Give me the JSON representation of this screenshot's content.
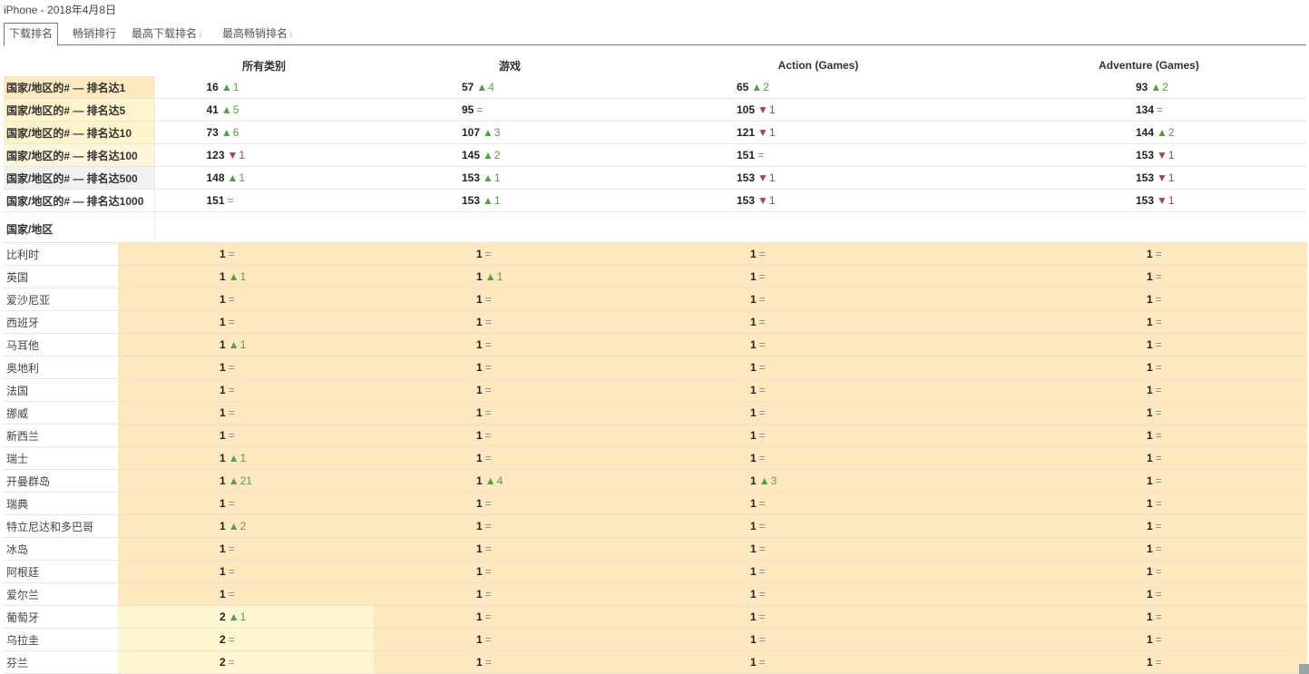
{
  "title": "iPhone - 2018年4月8日",
  "tabs": [
    {
      "label": "下载排名",
      "active": true,
      "info": ""
    },
    {
      "label": "畅销排行",
      "active": false,
      "info": ""
    },
    {
      "label": "最高下载排名",
      "active": false,
      "info": "i"
    },
    {
      "label": "最高畅销排名",
      "active": false,
      "info": "i"
    }
  ],
  "columns": [
    "所有类别",
    "游戏",
    "Action (Games)",
    "Adventure (Games)"
  ],
  "summary_rows": [
    {
      "label": "国家/地区的# — 排名达1",
      "level": "lvl1",
      "cells": [
        [
          "16",
          "up",
          "1"
        ],
        [
          "57",
          "up",
          "4"
        ],
        [
          "65",
          "up",
          "2"
        ],
        [
          "93",
          "up",
          "2"
        ]
      ]
    },
    {
      "label": "国家/地区的# — 排名达5",
      "level": "lvl5",
      "cells": [
        [
          "41",
          "up",
          "5"
        ],
        [
          "95",
          "eq",
          ""
        ],
        [
          "105",
          "down",
          "1"
        ],
        [
          "134",
          "eq",
          ""
        ]
      ]
    },
    {
      "label": "国家/地区的# — 排名达10",
      "level": "lvl5",
      "cells": [
        [
          "73",
          "up",
          "6"
        ],
        [
          "107",
          "up",
          "3"
        ],
        [
          "121",
          "down",
          "1"
        ],
        [
          "144",
          "up",
          "2"
        ]
      ]
    },
    {
      "label": "国家/地区的# — 排名达100",
      "level": "lvl100",
      "cells": [
        [
          "123",
          "down",
          "1"
        ],
        [
          "145",
          "up",
          "2"
        ],
        [
          "151",
          "eq",
          ""
        ],
        [
          "153",
          "down",
          "1"
        ]
      ]
    },
    {
      "label": "国家/地区的# — 排名达500",
      "level": "lvl500",
      "cells": [
        [
          "148",
          "up",
          "1"
        ],
        [
          "153",
          "up",
          "1"
        ],
        [
          "153",
          "down",
          "1"
        ],
        [
          "153",
          "down",
          "1"
        ]
      ]
    },
    {
      "label": "国家/地区的# — 排名达1000",
      "level": "lvl1000",
      "cells": [
        [
          "151",
          "eq",
          ""
        ],
        [
          "153",
          "up",
          "1"
        ],
        [
          "153",
          "down",
          "1"
        ],
        [
          "153",
          "down",
          "1"
        ]
      ]
    }
  ],
  "country_header": "国家/地区",
  "countries": [
    {
      "name": "比利时",
      "cells": [
        [
          "1",
          "eq",
          ""
        ],
        [
          "1",
          "eq",
          ""
        ],
        [
          "1",
          "eq",
          ""
        ],
        [
          "1",
          "eq",
          ""
        ]
      ]
    },
    {
      "name": "英国",
      "cells": [
        [
          "1",
          "up",
          "1"
        ],
        [
          "1",
          "up",
          "1"
        ],
        [
          "1",
          "eq",
          ""
        ],
        [
          "1",
          "eq",
          ""
        ]
      ]
    },
    {
      "name": "爱沙尼亚",
      "cells": [
        [
          "1",
          "eq",
          ""
        ],
        [
          "1",
          "eq",
          ""
        ],
        [
          "1",
          "eq",
          ""
        ],
        [
          "1",
          "eq",
          ""
        ]
      ]
    },
    {
      "name": "西班牙",
      "cells": [
        [
          "1",
          "eq",
          ""
        ],
        [
          "1",
          "eq",
          ""
        ],
        [
          "1",
          "eq",
          ""
        ],
        [
          "1",
          "eq",
          ""
        ]
      ]
    },
    {
      "name": "马耳他",
      "cells": [
        [
          "1",
          "up",
          "1"
        ],
        [
          "1",
          "eq",
          ""
        ],
        [
          "1",
          "eq",
          ""
        ],
        [
          "1",
          "eq",
          ""
        ]
      ]
    },
    {
      "name": "奥地利",
      "cells": [
        [
          "1",
          "eq",
          ""
        ],
        [
          "1",
          "eq",
          ""
        ],
        [
          "1",
          "eq",
          ""
        ],
        [
          "1",
          "eq",
          ""
        ]
      ]
    },
    {
      "name": "法国",
      "cells": [
        [
          "1",
          "eq",
          ""
        ],
        [
          "1",
          "eq",
          ""
        ],
        [
          "1",
          "eq",
          ""
        ],
        [
          "1",
          "eq",
          ""
        ]
      ]
    },
    {
      "name": "挪威",
      "cells": [
        [
          "1",
          "eq",
          ""
        ],
        [
          "1",
          "eq",
          ""
        ],
        [
          "1",
          "eq",
          ""
        ],
        [
          "1",
          "eq",
          ""
        ]
      ]
    },
    {
      "name": "新西兰",
      "cells": [
        [
          "1",
          "eq",
          ""
        ],
        [
          "1",
          "eq",
          ""
        ],
        [
          "1",
          "eq",
          ""
        ],
        [
          "1",
          "eq",
          ""
        ]
      ]
    },
    {
      "name": "瑞士",
      "cells": [
        [
          "1",
          "up",
          "1"
        ],
        [
          "1",
          "eq",
          ""
        ],
        [
          "1",
          "eq",
          ""
        ],
        [
          "1",
          "eq",
          ""
        ]
      ]
    },
    {
      "name": "开曼群岛",
      "cells": [
        [
          "1",
          "up",
          "21"
        ],
        [
          "1",
          "up",
          "4"
        ],
        [
          "1",
          "up",
          "3"
        ],
        [
          "1",
          "eq",
          ""
        ]
      ]
    },
    {
      "name": "瑞典",
      "cells": [
        [
          "1",
          "eq",
          ""
        ],
        [
          "1",
          "eq",
          ""
        ],
        [
          "1",
          "eq",
          ""
        ],
        [
          "1",
          "eq",
          ""
        ]
      ]
    },
    {
      "name": "特立尼达和多巴哥",
      "cells": [
        [
          "1",
          "up",
          "2"
        ],
        [
          "1",
          "eq",
          ""
        ],
        [
          "1",
          "eq",
          ""
        ],
        [
          "1",
          "eq",
          ""
        ]
      ]
    },
    {
      "name": "冰岛",
      "cells": [
        [
          "1",
          "eq",
          ""
        ],
        [
          "1",
          "eq",
          ""
        ],
        [
          "1",
          "eq",
          ""
        ],
        [
          "1",
          "eq",
          ""
        ]
      ]
    },
    {
      "name": "阿根廷",
      "cells": [
        [
          "1",
          "eq",
          ""
        ],
        [
          "1",
          "eq",
          ""
        ],
        [
          "1",
          "eq",
          ""
        ],
        [
          "1",
          "eq",
          ""
        ]
      ]
    },
    {
      "name": "爱尔兰",
      "cells": [
        [
          "1",
          "eq",
          ""
        ],
        [
          "1",
          "eq",
          ""
        ],
        [
          "1",
          "eq",
          ""
        ],
        [
          "1",
          "eq",
          ""
        ]
      ]
    },
    {
      "name": "葡萄牙",
      "cells": [
        [
          "2",
          "up",
          "1"
        ],
        [
          "1",
          "eq",
          ""
        ],
        [
          "1",
          "eq",
          ""
        ],
        [
          "1",
          "eq",
          ""
        ]
      ]
    },
    {
      "name": "乌拉圭",
      "cells": [
        [
          "2",
          "eq",
          ""
        ],
        [
          "1",
          "eq",
          ""
        ],
        [
          "1",
          "eq",
          ""
        ],
        [
          "1",
          "eq",
          ""
        ]
      ]
    },
    {
      "name": "芬兰",
      "cells": [
        [
          "2",
          "eq",
          ""
        ],
        [
          "1",
          "eq",
          ""
        ],
        [
          "1",
          "eq",
          ""
        ],
        [
          "1",
          "eq",
          ""
        ]
      ]
    }
  ],
  "symbols": {
    "up": "▲",
    "down": "▼",
    "eq": "="
  },
  "colors": {
    "up": "#5a9a4a",
    "down": "#9a4a4a",
    "rank1_fill": "#fde8c0",
    "rank5_fill": "#fef4cc",
    "tab_border": "#5b7f8a"
  }
}
